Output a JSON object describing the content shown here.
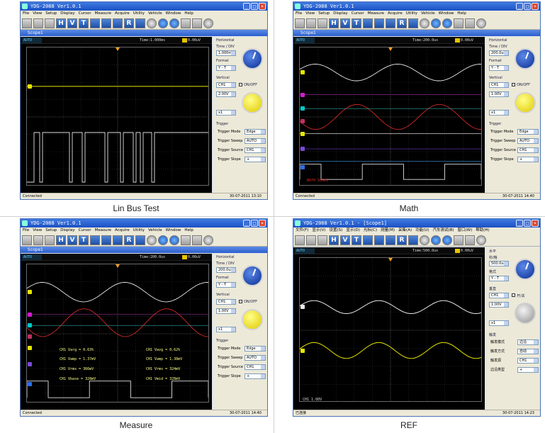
{
  "panels": [
    {
      "caption": "Lin Bus Test",
      "window_title": "YDG-2088 Ver1.0.1",
      "scope_title": "Scope1",
      "time_label": "Time:1.000ms",
      "trig_label": "0.00uV",
      "mode": "AUTO",
      "status": "Connected",
      "date": "30-07-2011",
      "clock": "13:10",
      "horizontal": {
        "header": "Horizontal",
        "time_div_label": "Time / DIV",
        "time_div": "1.000ms",
        "format_label": "Format",
        "format": "Y - T"
      },
      "vertical": {
        "header": "Vertical",
        "channel": "CH1",
        "onoff": "ON/OFF",
        "volt": "2.00V",
        "probe": "x1"
      },
      "trigger": {
        "header": "Trigger",
        "rows": [
          {
            "label": "Trigger Mode",
            "value": "Edge"
          },
          {
            "label": "Trigger Sweep",
            "value": "AUTO"
          },
          {
            "label": "Trigger Source",
            "value": "CH1"
          },
          {
            "label": "Trigger Slope",
            "value": "+"
          }
        ]
      }
    },
    {
      "caption": "Math",
      "window_title": "YDG-2088 Ver1.0.1",
      "scope_title": "Scope1",
      "time_label": "Time:200.0us",
      "trig_label": "0.00uV",
      "mode": "AUTO",
      "status": "Connected",
      "date": "30-07-2011",
      "clock": "14:40",
      "horizontal": {
        "header": "Horizontal",
        "time_div_label": "Time / DIV",
        "time_div": "200.0us",
        "format_label": "Format",
        "format": "Y - T"
      },
      "vertical": {
        "header": "Vertical",
        "channel": "CH1",
        "onoff": "ON/OFF",
        "volt": "1.00V",
        "probe": "x1"
      },
      "trigger": {
        "header": "Trigger",
        "rows": [
          {
            "label": "Trigger Mode",
            "value": "Edge"
          },
          {
            "label": "Trigger Sweep",
            "value": "AUTO"
          },
          {
            "label": "Trigger Source",
            "value": "CH1"
          },
          {
            "label": "Trigger Slope",
            "value": "+"
          }
        ]
      },
      "math_label": "MATH 500mV"
    },
    {
      "caption": "Measure",
      "window_title": "YDG-2088 Ver1.0.1",
      "scope_title": "Scope1",
      "time_label": "Time:200.0us",
      "trig_label": "0.00uV",
      "mode": "AUTO",
      "status": "Connected",
      "date": "30-07-2011",
      "clock": "14:40",
      "horizontal": {
        "header": "Horizontal",
        "time_div_label": "Time / DIV",
        "time_div": "200.0us",
        "format_label": "Format",
        "format": "Y - T"
      },
      "vertical": {
        "header": "Vertical",
        "channel": "CH1",
        "onoff": "ON/OFF",
        "volt": "1.00V",
        "probe": "x1"
      },
      "trigger": {
        "header": "Trigger",
        "rows": [
          {
            "label": "Trigger Mode",
            "value": "Edge"
          },
          {
            "label": "Trigger Sweep",
            "value": "AUTO"
          },
          {
            "label": "Trigger Source",
            "value": "CH1"
          },
          {
            "label": "Trigger Slope",
            "value": "+"
          }
        ]
      },
      "measurements": [
        "CH1 Varg = 0.63%",
        "CH1 Vavg = 0.62%",
        "CH1 Vamp = 1.37mV",
        "CH1 Vamp = 1.38mV",
        "CH1 Vrms = 366mV",
        "CH1 Vrms = 324mV",
        "CH1 Vbase = 328mV",
        "CH1 Vmid = 328mV"
      ]
    },
    {
      "caption": "REF",
      "window_title": "YDG-2088 Ver1.0.1 - [Scope1]",
      "time_label": "Time:500.0us",
      "trig_label": "0.00uV",
      "mode": "AUTO",
      "status": "已连接",
      "date": "30-07-2011",
      "clock": "14:23",
      "ch_label": "CH1",
      "ch_value": "1.00V",
      "horizontal": {
        "header": "水平",
        "time_div_label": "秒/格",
        "time_div": "500.0us",
        "format_label": "格式",
        "format": "Y - T"
      },
      "vertical": {
        "header": "垂直",
        "channel": "CH1",
        "onoff": "开/关",
        "volt": "1.00V",
        "probe": "x1"
      },
      "trigger": {
        "header": "触发",
        "rows": [
          {
            "label": "触发模式",
            "value": "边沿"
          },
          {
            "label": "触发方式",
            "value": "自动"
          },
          {
            "label": "触发源",
            "value": "CH1"
          },
          {
            "label": "边沿类型",
            "value": "+"
          }
        ]
      }
    }
  ],
  "menu_en": [
    "File",
    "View",
    "Setup",
    "Display",
    "Cursor",
    "Measure",
    "Acquire",
    "Utility",
    "Vehicle",
    "Window",
    "Help"
  ],
  "menu_cn": [
    "文件(F)",
    "显示(V)",
    "设置(S)",
    "显示(D)",
    "光标(C)",
    "测量(M)",
    "采集(A)",
    "功能(U)",
    "汽车测试(B)",
    "窗口(W)",
    "帮助(H)"
  ],
  "toolbar": [
    "H",
    "V",
    "T",
    "R"
  ],
  "colors": {
    "ch1": "#e6e600",
    "ch2": "#00c8c8",
    "ch3": "#d21bd2",
    "ch4": "#2d6ef0",
    "math": "#d22828",
    "ref": "#e8e8e8",
    "grid": "#3a3a3a",
    "screen_bg": "#000000"
  }
}
